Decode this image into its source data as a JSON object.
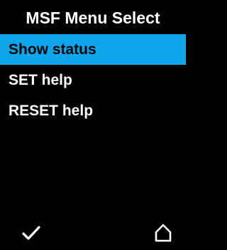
{
  "header": {
    "title": "MSF Menu Select"
  },
  "menu": {
    "selected_index": 0,
    "items": [
      {
        "label": "Show status"
      },
      {
        "label": "SET help"
      },
      {
        "label": "RESET help"
      }
    ]
  },
  "softkeys": {
    "left_icon": "checkmark-icon",
    "right_icon": "home-icon"
  },
  "colors": {
    "background": "#000000",
    "highlight": "#0fa5ea",
    "text": "#ffffff",
    "selected_text": "#000000"
  }
}
